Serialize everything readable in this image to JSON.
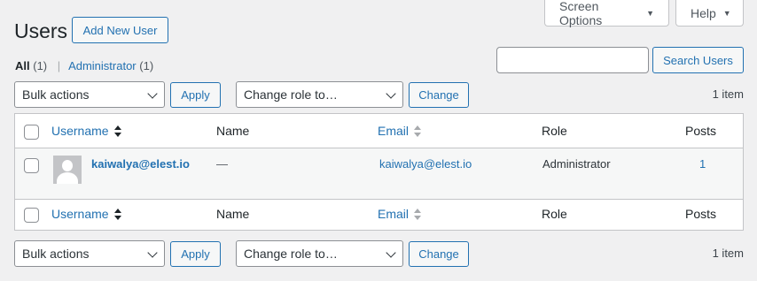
{
  "screen_options": {
    "label": "Screen Options",
    "icon": "caret-down-icon"
  },
  "help": {
    "label": "Help",
    "icon": "caret-down-icon"
  },
  "page": {
    "title": "Users",
    "add_new_label": "Add New User"
  },
  "views": {
    "all_label": "All",
    "all_count": "(1)",
    "separator": "|",
    "admin_label": "Administrator",
    "admin_count": "(1)"
  },
  "search": {
    "value": "",
    "button_label": "Search Users"
  },
  "top_nav": {
    "bulk_actions": "Bulk actions",
    "apply_label": "Apply",
    "change_role": "Change role to…",
    "change_label": "Change",
    "item_count": "1 item"
  },
  "bottom_nav": {
    "bulk_actions": "Bulk actions",
    "apply_label": "Apply",
    "change_role": "Change role to…",
    "change_label": "Change",
    "item_count": "1 item"
  },
  "table": {
    "columns": [
      "Username",
      "Name",
      "Email",
      "Role",
      "Posts"
    ],
    "rows": [
      {
        "username": "kaiwalya@elest.io",
        "name": "—",
        "email": "kaiwalya@elest.io",
        "role": "Administrator",
        "posts": "1"
      }
    ]
  },
  "colors": {
    "accent": "#2271b1",
    "background": "#f0f0f1",
    "text": "#1d2327"
  }
}
